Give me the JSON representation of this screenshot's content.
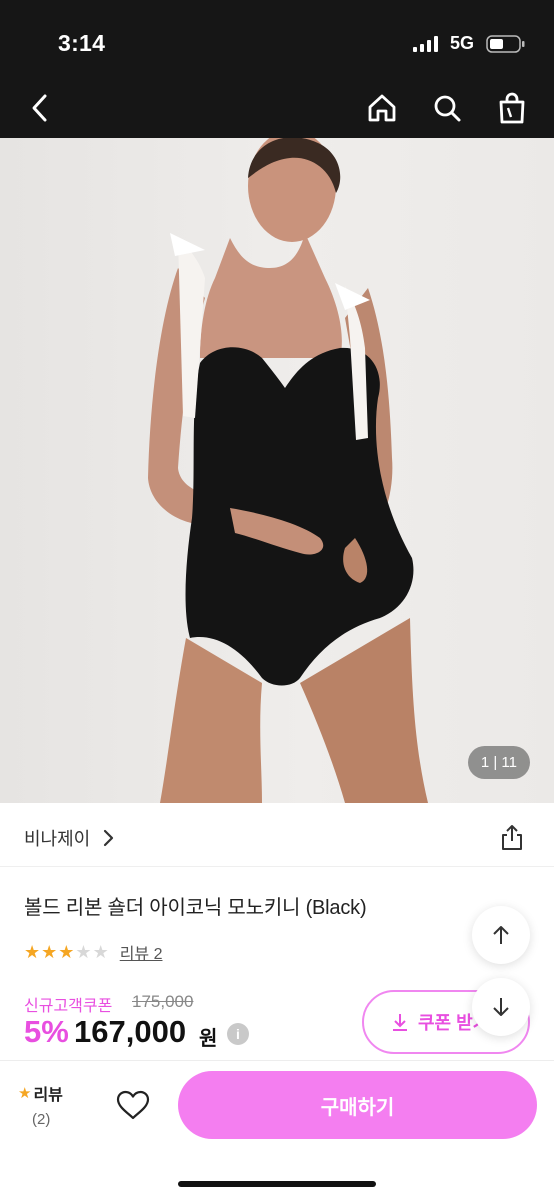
{
  "status_bar": {
    "time": "3:14",
    "network": "5G",
    "icons": [
      "signal-icon",
      "battery-icon"
    ]
  },
  "nav_bar": {
    "icons": [
      "back-icon",
      "home-icon",
      "search-icon",
      "shopping-bag-icon"
    ]
  },
  "gallery": {
    "counter": "1 | 11"
  },
  "product": {
    "brand": "비나제이",
    "title": "볼드 리본 숄더 아이코닉 모노키니 (Black)",
    "rating": 3,
    "rating_max": 5,
    "review_link": "리뷰 2",
    "coupon_label": "신규고객쿠폰",
    "original_price": "175,000",
    "discount": "5%",
    "price": "167,000",
    "currency": "원",
    "info_symbol": "i",
    "coupon_button": "쿠폰 받기"
  },
  "bottom_bar": {
    "review_label": "리뷰",
    "review_count": "(2)",
    "buy_label": "구매하기"
  },
  "colors": {
    "accent_pink": "#e84fe0",
    "buy_button": "#f47ef0",
    "star_filled": "#f5a623",
    "star_empty": "#d8d8d8",
    "status_bar_bg": "#161616"
  }
}
